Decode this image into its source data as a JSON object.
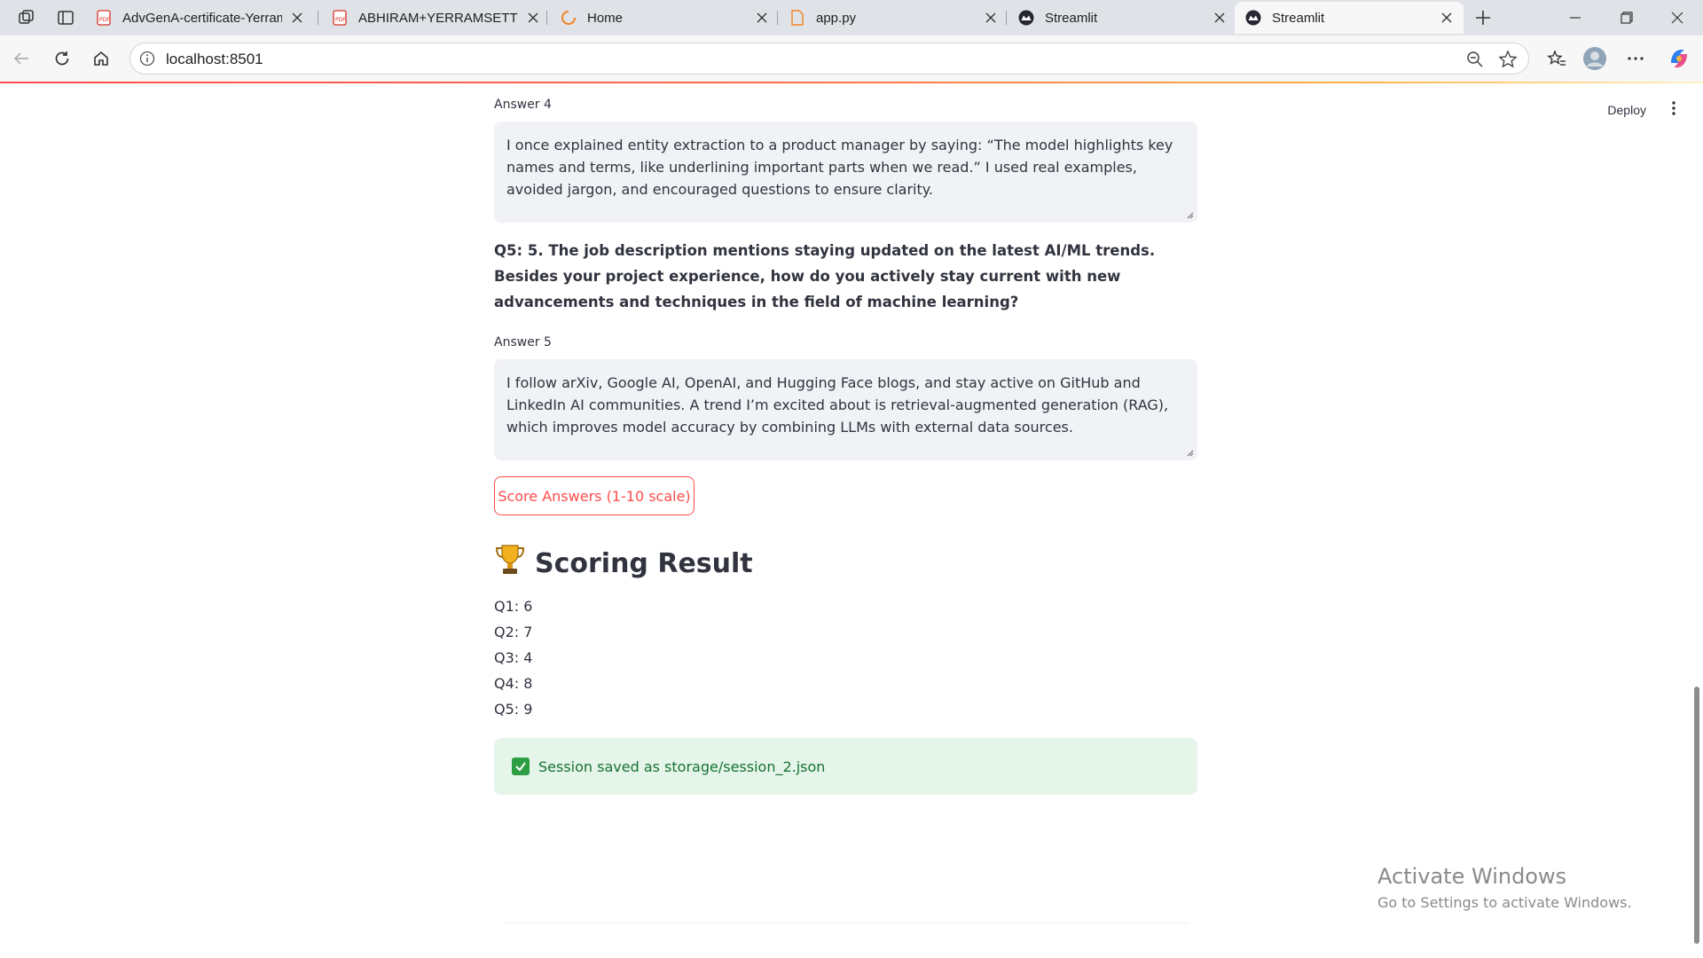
{
  "browser": {
    "tabs": [
      {
        "title": "AdvGenA-certificate-Yerram",
        "icon": "pdf-icon",
        "active": false
      },
      {
        "title": "ABHIRAM+YERRAMSETTI_r",
        "icon": "pdf-icon",
        "active": false
      },
      {
        "title": "Home",
        "icon": "loading-icon",
        "active": false
      },
      {
        "title": "app.py",
        "icon": "file-icon",
        "active": false
      },
      {
        "title": "Streamlit",
        "icon": "streamlit-icon",
        "active": false
      },
      {
        "title": "Streamlit",
        "icon": "streamlit-icon",
        "active": true
      }
    ],
    "address": "localhost:8501"
  },
  "header": {
    "deploy_label": "Deploy"
  },
  "answer4": {
    "label": "Answer 4",
    "text": "I once explained entity extraction to a product manager by saying: “The model highlights key names and terms, like underlining important parts when we read.” I used real examples, avoided jargon, and encouraged questions to ensure clarity."
  },
  "question5": {
    "text": "Q5: 5. The job description mentions staying updated on the latest AI/ML trends. Besides your project experience, how do you actively stay current with new advancements and techniques in the field of machine learning?"
  },
  "answer5": {
    "label": "Answer 5",
    "text": "I follow arXiv, Google AI, OpenAI, and Hugging Face blogs, and stay active on GitHub and LinkedIn AI communities. A trend I’m excited about is retrieval-augmented generation (RAG), which improves model accuracy by combining LLMs with external data sources."
  },
  "score_button": {
    "label": "Score Answers (1-10 scale)"
  },
  "result": {
    "title": "Scoring Result",
    "icon": "trophy-icon",
    "scores": [
      "Q1: 6",
      "Q2: 7",
      "Q3: 4",
      "Q4: 8",
      "Q5: 9"
    ]
  },
  "success": {
    "text": "Session saved as storage/session_2.json",
    "icon": "check-icon"
  },
  "watermark": {
    "line1": "Activate Windows",
    "line2": "Go to Settings to activate Windows."
  },
  "colors": {
    "accent": "#ff4b4b",
    "success_bg": "#e5f5ea",
    "success_text": "#177233",
    "input_bg": "#f0f2f6"
  }
}
